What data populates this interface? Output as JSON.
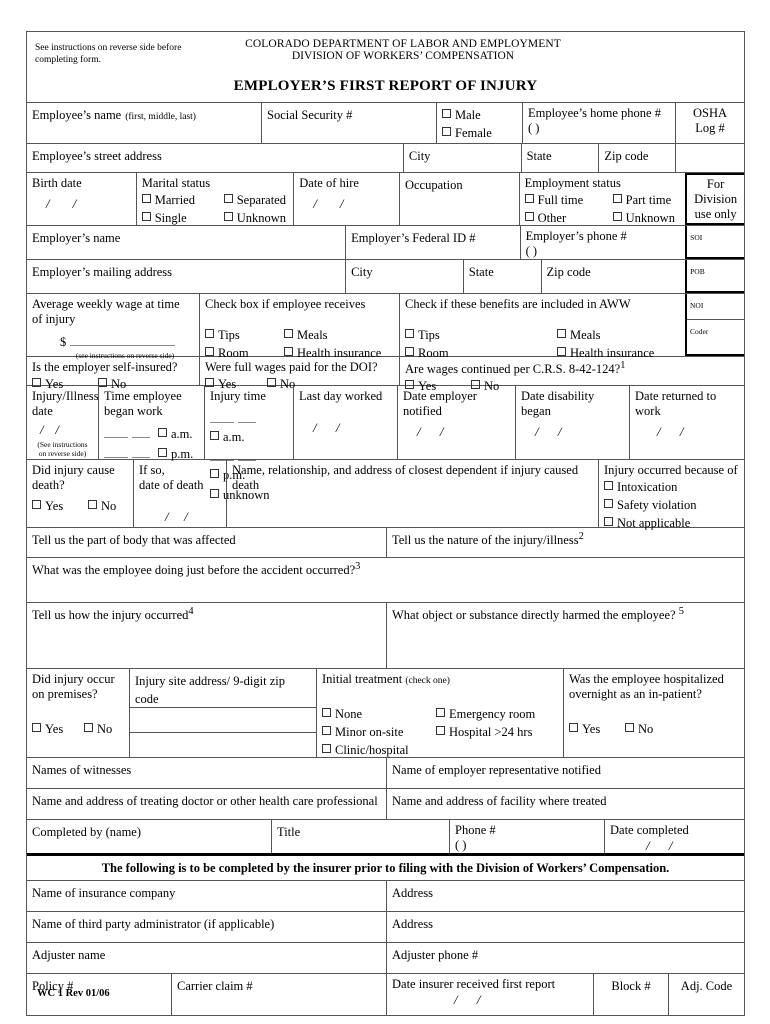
{
  "header": {
    "instructions": "See instructions on reverse side before completing form.",
    "agency_line1": "COLORADO DEPARTMENT OF LABOR AND EMPLOYMENT",
    "agency_line2": "DIVISION OF WORKERS’ COMPENSATION",
    "title": "EMPLOYER’S FIRST REPORT OF INJURY"
  },
  "employee": {
    "name_label": "Employee’s name",
    "name_hint": "(first, middle, last)",
    "ssn_label": "Social Security #",
    "sex_male": "Male",
    "sex_female": "Female",
    "home_phone_label": "Employee’s home phone #",
    "phone_parens": "(        )",
    "osha_label_1": "OSHA",
    "osha_label_2": "Log #",
    "street_label": "Employee’s street address",
    "city_label": "City",
    "state_label": "State",
    "zip_label": "Zip code",
    "birth_date_label": "Birth date",
    "marital_status_label": "Marital status",
    "marital_married": "Married",
    "marital_separated": "Separated",
    "marital_single": "Single",
    "marital_unknown": "Unknown",
    "date_of_hire_label": "Date of hire",
    "occupation_label": "Occupation",
    "employment_status_label": "Employment status",
    "emp_full_time": "Full time",
    "emp_part_time": "Part time",
    "emp_other": "Other",
    "emp_unknown": "Unknown"
  },
  "division_box": {
    "line1": "For",
    "line2": "Division",
    "line3": "use only",
    "codes": [
      "SOI",
      "POB",
      "NOI",
      "Coder"
    ]
  },
  "employer": {
    "name_label": "Employer’s name",
    "fein_label": "Employer’s Federal ID #",
    "phone_label": "Employer’s phone #",
    "phone_parens": "(        )",
    "mailing_label": "Employer’s mailing address",
    "city_label": "City",
    "state_label": "State",
    "zip_label": "Zip code"
  },
  "wage": {
    "aww_line1": "Average weekly wage at time",
    "aww_line2": "of injury",
    "dollar": "$",
    "aww_note": "(see instructions on reverse side)",
    "receives_label": "Check box if employee receives",
    "receives_options": [
      "Tips",
      "Meals",
      "Room",
      "Health insurance"
    ],
    "included_label": "Check if these benefits are included in AWW",
    "included_options": [
      "Tips",
      "Meals",
      "Room",
      "Health insurance"
    ],
    "self_insured_label": "Is the employer self-insured?",
    "full_wages_label": "Were full wages paid for the DOI?",
    "wages_continued_label": "Are wages continued per C.R.S. 8-42-124?",
    "wages_continued_sup": "1",
    "yes": "Yes",
    "no": "No"
  },
  "dates": {
    "injury_date_l1": "Injury/Illness",
    "injury_date_l2": "date",
    "injury_date_note_l1": "(See instructions",
    "injury_date_note_l2": "on reverse side)",
    "time_began_l1": "Time employee",
    "time_began_l2": "began work",
    "injury_time_label": "Injury time",
    "am": "a.m.",
    "pm": "p.m.",
    "unknown": "unknown",
    "last_day_worked": "Last day worked",
    "date_notified_l1": "Date employer",
    "date_notified_l2": "notified",
    "date_disability_l1": "Date disability",
    "date_disability_l2": "began",
    "date_returned_l1": "Date returned to",
    "date_returned_l2": "work"
  },
  "death": {
    "cause_death_l1": "Did injury cause",
    "cause_death_l2": "death?",
    "yes": "Yes",
    "no": "No",
    "if_so_l1": "If so,",
    "if_so_l2": "date of death",
    "dependent_l1": "Name, relationship, and address of closest dependent if injury caused",
    "dependent_l2": "death",
    "because_of_label": "Injury occurred because of",
    "because_options": [
      "Intoxication",
      "Safety violation",
      "Not applicable"
    ]
  },
  "injury_detail": {
    "part_of_body": "Tell us the part of body that was affected",
    "nature_label": "Tell us the nature of the injury/illness",
    "nature_sup": "2",
    "doing_before_label": "What was the employee doing just before the accident occurred?",
    "doing_before_sup": "3",
    "how_occurred_label": "Tell us how the injury occurred",
    "how_occurred_sup": "4",
    "object_label": "What object or substance directly harmed the employee?",
    "object_sup": "5"
  },
  "premises": {
    "on_premises_l1": "Did injury occur",
    "on_premises_l2": "on premises?",
    "yes": "Yes",
    "no": "No",
    "site_address_label": "Injury site address/ 9-digit zip code",
    "initial_treatment_label": "Initial treatment",
    "initial_treatment_hint": "(check one)",
    "treatment_options_left": [
      "None",
      "Minor on-site",
      "Clinic/hospital"
    ],
    "treatment_options_right": [
      "Emergency room",
      "Hospital >24 hrs"
    ],
    "hospitalized_l1": "Was the employee hospitalized",
    "hospitalized_l2": "overnight as an in-patient?"
  },
  "witness": {
    "witnesses_label": "Names of witnesses",
    "representative_label": "Name of employer representative notified",
    "doctor_label": "Name and address of treating doctor or other health care professional",
    "facility_label": "Name and address of facility where treated"
  },
  "completed": {
    "completed_by_label": "Completed by (name)",
    "title_label": "Title",
    "phone_label": "Phone #",
    "phone_parens": "(        )",
    "date_completed_label": "Date completed"
  },
  "insurer": {
    "banner": "The following is to be completed by the insurer prior to filing with the Division of Workers’ Compensation.",
    "insurance_company_label": "Name of insurance company",
    "address_label_1": "Address",
    "tpa_label": "Name of third party administrator (if applicable)",
    "address_label_2": "Address",
    "adjuster_name_label": "Adjuster name",
    "adjuster_phone_label": "Adjuster phone #",
    "policy_label": "Policy #",
    "carrier_claim_label": "Carrier claim #",
    "date_received_label": "Date insurer received first report",
    "block_label": "Block #",
    "adj_code_label": "Adj. Code"
  },
  "footer": {
    "revision": "WC 1 Rev 01/06"
  }
}
